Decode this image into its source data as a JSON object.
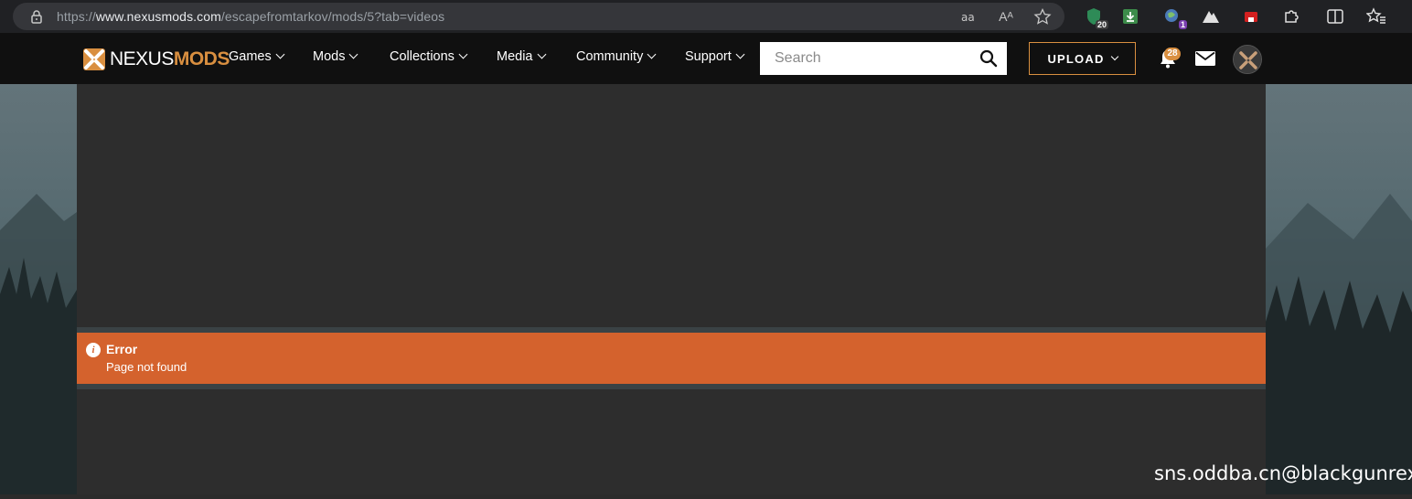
{
  "browser": {
    "url_prefix": "https://",
    "url_host": "www.nexusmods.com",
    "url_path": "/escapefromtarkov/mods/5?tab=videos",
    "read_aloud_icon": "Aᴬ",
    "extensions": [
      {
        "name": "shield-extension-icon",
        "badge": "20",
        "color": "#2e8b57"
      },
      {
        "name": "download-extension-icon",
        "badge": "",
        "color": "#3c8c4a"
      },
      {
        "name": "globe-extension-icon",
        "badge": "1",
        "color": "#4a7ab8"
      },
      {
        "name": "mountain-extension-icon",
        "badge": "",
        "color": "#e0e0e0"
      },
      {
        "name": "red-extension-icon",
        "badge": "",
        "color": "#d42020"
      },
      {
        "name": "puzzle-extension-icon",
        "badge": "",
        "color": "#e0e0e0"
      },
      {
        "name": "split-screen-icon",
        "badge": "",
        "color": "#e0e0e0"
      },
      {
        "name": "favorites-icon",
        "badge": "",
        "color": "#e0e0e0"
      }
    ]
  },
  "header": {
    "logo_left": "NEXUS",
    "logo_right": "MODS",
    "nav": [
      {
        "label": "Games"
      },
      {
        "label": "Mods"
      },
      {
        "label": "Collections"
      },
      {
        "label": "Media"
      },
      {
        "label": "Community"
      },
      {
        "label": "Support"
      }
    ],
    "search_placeholder": "Search",
    "upload_label": "UPLOAD",
    "notification_count": "28"
  },
  "error": {
    "title": "Error",
    "message": "Page not found"
  },
  "watermark": "sns.oddba.cn@blackgunrex",
  "colors": {
    "brand_orange": "#d98f40",
    "error_bg": "#d4622d",
    "header_bg": "#101010",
    "content_bg": "#2d2d2d"
  }
}
